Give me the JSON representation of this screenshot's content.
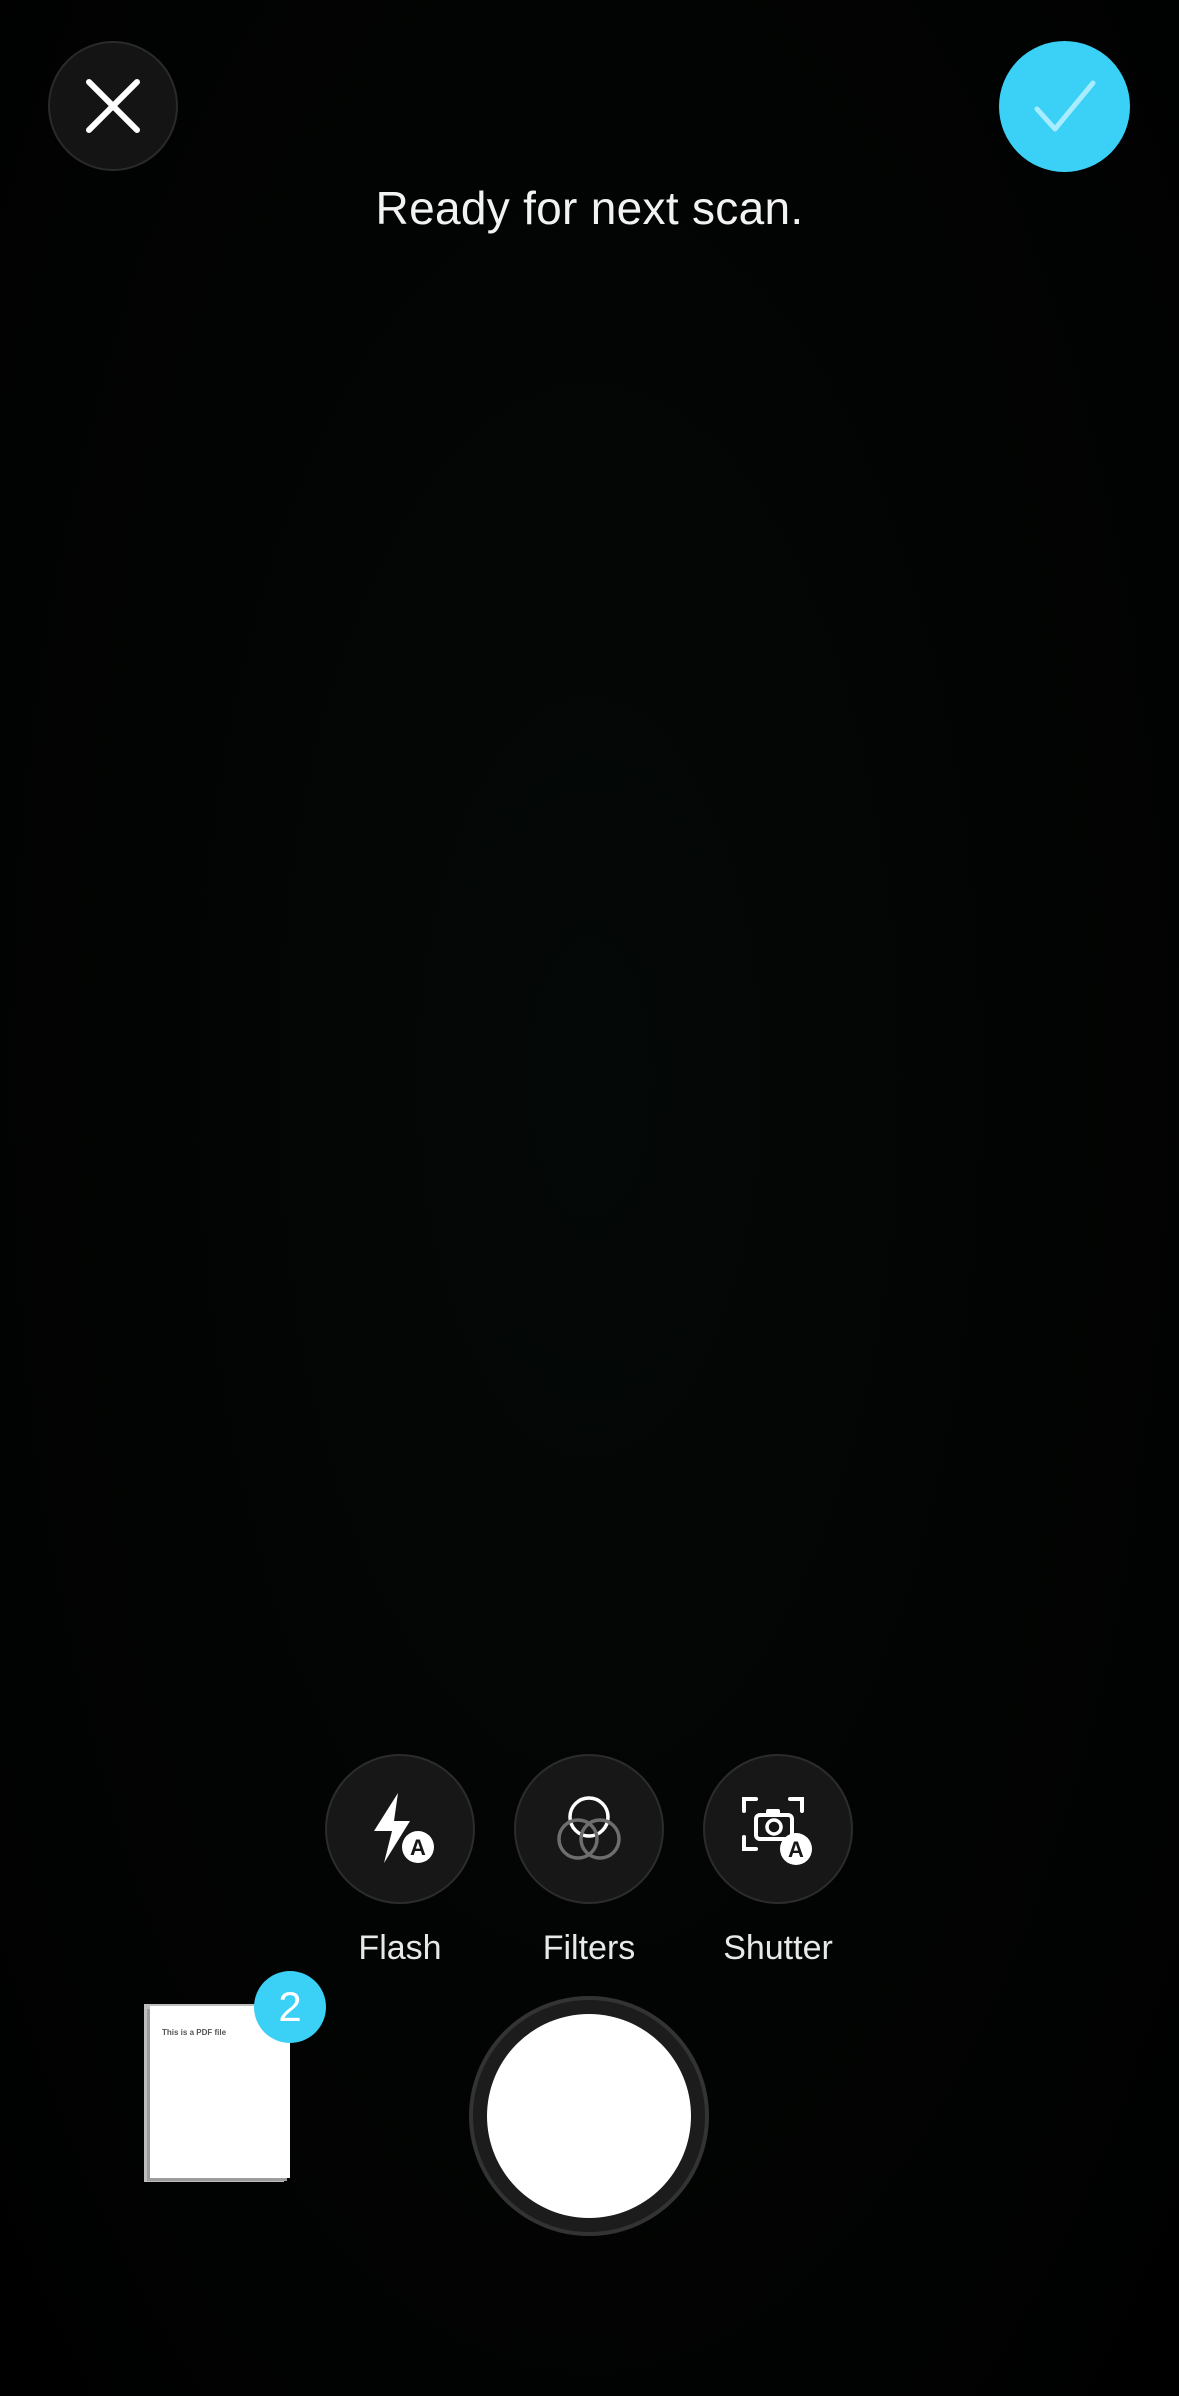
{
  "colors": {
    "accent": "#3bd0f5",
    "background": "#000000"
  },
  "header": {
    "close_icon": "close-icon",
    "done_icon": "checkmark-icon",
    "status": "Ready for next scan."
  },
  "tools": [
    {
      "label": "Flash",
      "icon": "flash-auto-icon"
    },
    {
      "label": "Filters",
      "icon": "filters-icon"
    },
    {
      "label": "Shutter",
      "icon": "auto-shutter-icon"
    }
  ],
  "preview": {
    "page_count": "2",
    "page_text": "This is a PDF file"
  },
  "capture": {
    "icon": "shutter-button"
  }
}
